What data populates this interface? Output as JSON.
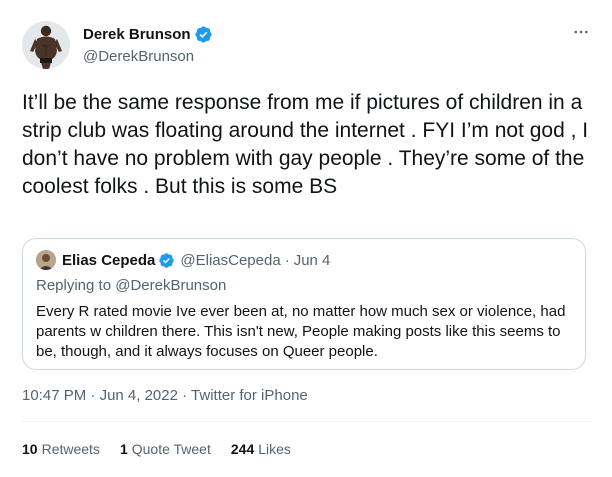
{
  "tweet": {
    "author": {
      "name": "Derek Brunson",
      "handle": "@DerekBrunson"
    },
    "text": "It’ll be the same response from me if pictures of children in a strip club was floating around the internet . FYI I’m not god , I don’t have no problem with gay people . They’re some of the coolest folks . But this is some BS",
    "time": "10:47 PM",
    "date": "Jun 4, 2022",
    "source": "Twitter for iPhone",
    "separator": "·"
  },
  "quote": {
    "author": {
      "name": "Elias Cepeda",
      "handle": "@EliasCepeda"
    },
    "date": "Jun 4",
    "separator": "·",
    "replying_to_label": "Replying to",
    "replying_to_handle": "@DerekBrunson",
    "text": "Every R rated movie Ive ever been at, no matter how much sex or violence, had parents w children there. This isn't new, People making posts like this seems to be, though, and it always focuses on Queer people."
  },
  "stats": {
    "retweets_count": "10",
    "retweets_label": "Retweets",
    "quotes_count": "1",
    "quotes_label": "Quote Tweet",
    "likes_count": "244",
    "likes_label": "Likes"
  },
  "icons": {
    "verified": "verified-badge-icon",
    "more": "more-options-icon"
  },
  "colors": {
    "verified_blue": "#1d9bf0",
    "text_primary": "#0f1419",
    "text_secondary": "#536471",
    "border": "#cfd9de"
  }
}
